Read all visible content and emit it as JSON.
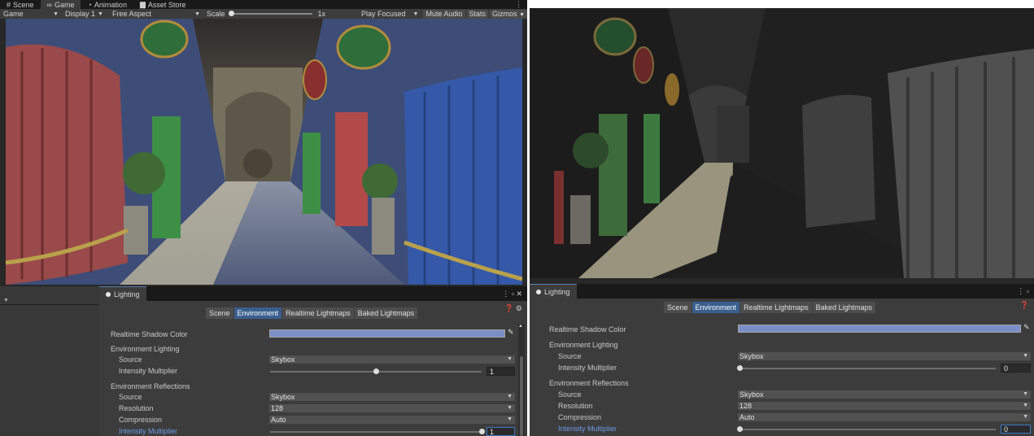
{
  "left": {
    "tabs": [
      {
        "label": "Scene",
        "icon": "grid-icon"
      },
      {
        "label": "Game",
        "icon": "gamepad-icon"
      },
      {
        "label": "Animation",
        "icon": "animation-icon"
      },
      {
        "label": "Asset Store",
        "icon": "store-icon"
      }
    ],
    "tabs_menu": "⋮",
    "toolbar": {
      "mode": "Game",
      "display": "Display 1",
      "aspect": "Free Aspect",
      "scale_label": "Scale",
      "scale_value": "1x",
      "play_focused": "Play Focused",
      "mute_audio": "Mute Audio",
      "stats": "Stats",
      "gizmos": "Gizmos"
    },
    "lighting": {
      "title": "Lighting",
      "ctrls": "⋮ ▫ ✕",
      "help": "❓ ⚙",
      "tabs": [
        "Scene",
        "Environment",
        "Realtime Lightmaps",
        "Baked Lightmaps"
      ],
      "selected_tab": "Environment",
      "rows": {
        "shadow_color": "Realtime Shadow Color",
        "env_lighting": "Environment Lighting",
        "source": "Source",
        "intensity": "Intensity Multiplier",
        "env_reflections": "Environment Reflections",
        "refl_source": "Source",
        "resolution": "Resolution",
        "compression": "Compression",
        "refl_intensity": "Intensity Multiplier"
      },
      "values": {
        "source": "Skybox",
        "intensity": "1",
        "refl_source": "Skybox",
        "resolution": "128",
        "compression": "Auto",
        "refl_intensity": "1"
      },
      "intensity_level": 0.5,
      "refl_intensity_level": 1.0
    }
  },
  "right": {
    "lighting": {
      "title": "Lighting",
      "ctrls": "⋮ ▫",
      "help": "❓",
      "tabs": [
        "Scene",
        "Environment",
        "Realtime Lightmaps",
        "Baked Lightmaps"
      ],
      "selected_tab": "Environment",
      "rows": {
        "shadow_color": "Realtime Shadow Color",
        "env_lighting": "Environment Lighting",
        "source": "Source",
        "intensity": "Intensity Multiplier",
        "env_reflections": "Environment Reflections",
        "refl_source": "Source",
        "resolution": "Resolution",
        "compression": "Compression",
        "refl_intensity": "Intensity Multiplier"
      },
      "values": {
        "source": "Skybox",
        "intensity": "0",
        "refl_source": "Skybox",
        "resolution": "128",
        "compression": "Auto",
        "refl_intensity": "0"
      },
      "intensity_level": 0.0,
      "refl_intensity_level": 0.0
    }
  },
  "colors": {
    "accent": "#3a5f8f",
    "highlight_label": "#6f9ae6",
    "shadow_color": "#7a8ec8"
  }
}
